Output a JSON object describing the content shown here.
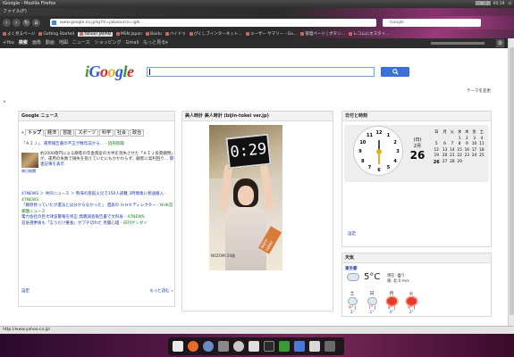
{
  "window": {
    "title": "iGoogle - Mozilla Firefox",
    "clock": "00:19",
    "user_label": "▒▒▒▒▒"
  },
  "menu": {
    "label": "ファイル(F)"
  },
  "nav": {
    "url": "www.google.co.jp/ig?hl=ja&source=iglk",
    "search_placeholder": "Google"
  },
  "bookmarks": [
    {
      "label": "よく見るページ"
    },
    {
      "label": "Getting Started"
    },
    {
      "label": "Yahoo! JAPAN"
    },
    {
      "label": "MSN Japan"
    },
    {
      "label": "Baidu"
    },
    {
      "label": "バイドゥ"
    },
    {
      "label": "ぴくしブインターネット…"
    },
    {
      "label": "ユーザー サマリー - Go…"
    },
    {
      "label": "管理ページ | ボタン…"
    },
    {
      "label": "レコムにオスタイ…"
    }
  ],
  "gbar": {
    "items": [
      "+You",
      "検索",
      "画像",
      "動画",
      "地図",
      "ニュース",
      "ショッピング",
      "Gmail",
      "もっと見る▾"
    ],
    "gear_label": "⚙"
  },
  "logo": {
    "i": "i",
    "G": "G",
    "o1": "o",
    "o2": "o",
    "g": "g",
    "l": "l",
    "e": "e"
  },
  "search": {
    "value": ""
  },
  "theme_link": "テーマを変更",
  "collapse_arrow": "▸",
  "news": {
    "title": "Google ニュース",
    "prev": "«",
    "tabs": [
      "トップ",
      "経済",
      "芸能",
      "スポーツ",
      "科学",
      "社会",
      "政治"
    ],
    "headline": "「ＡＩＪ」、運用報告書の不正が数年前から…",
    "headline_source": "- 読売新聞",
    "lead_parts": [
      "約2000億円による顧客の年金資産の大半を消失させた「ＡＩＪ投資顧問」が、運用の失敗で損失を抱えていたにもかかわらず、顧客に高利回り…",
      "関連記事を表示"
    ],
    "thumb_caption": "毎日新聞",
    "items": [
      {
        "text": "47NEWS ＞ 共同ニュース ＞ 熟海の旅館火災で150人避難 3時間後に移送搬入",
        "source": "- 47NEWS"
      },
      {
        "text": "「藤原修っていたが遺法とは分からなかった」 遺族の ＮＨＫディレクター",
        "source": "- NHK首都圏ニュース"
      },
      {
        "text": "電力会社の巨大津波警報を修正 発震調査報告書で文科省 -",
        "source": "47NEWS"
      },
      {
        "text": "首長選挙後も「言うだけ番長」がプチ切れた 見聞心理 -",
        "source": "日刊ゲンダイ"
      }
    ],
    "settings": "設定",
    "more": "もっと読む »"
  },
  "bijin": {
    "title": "美人時計 美人時計 (bijin-tokei ver.jp)",
    "time": "0:29",
    "stamp": "bijin-tokei",
    "credit": "NOZOMI 20歳"
  },
  "datetime": {
    "title": "日付と時刻",
    "day_label": "(日)",
    "month_label": "2月",
    "day": "26",
    "clock_numbers": [
      "12",
      "1",
      "2",
      "3",
      "4",
      "5",
      "6",
      "7",
      "8",
      "9",
      "10",
      "11"
    ],
    "weekdays": [
      "日",
      "月",
      "火",
      "水",
      "木",
      "金",
      "土"
    ],
    "weeks": [
      [
        "",
        "",
        "",
        "1",
        "2",
        "3",
        "4"
      ],
      [
        "5",
        "6",
        "7",
        "8",
        "9",
        "10",
        "11"
      ],
      [
        "12",
        "13",
        "14",
        "15",
        "16",
        "17",
        "18"
      ],
      [
        "19",
        "20",
        "21",
        "22",
        "23",
        "24",
        "25"
      ],
      [
        "26",
        "27",
        "28",
        "29",
        "",
        "",
        ""
      ]
    ],
    "settings": "設定"
  },
  "weather": {
    "title": "天気",
    "city": "東京都",
    "temp": "5°C",
    "condition": "現在: 曇り",
    "wind": "風: 北 0 m/s",
    "days": [
      {
        "name": "土",
        "hi": "9°",
        "lo": "3°",
        "kind": "cloud"
      },
      {
        "name": "日",
        "hi": "7°",
        "lo": "1°",
        "kind": "cloud"
      },
      {
        "name": "月",
        "hi": "8°",
        "lo": "0°",
        "kind": "sun"
      },
      {
        "name": "火",
        "hi": "9°",
        "lo": "3°",
        "kind": "sun"
      }
    ]
  },
  "status": {
    "text": "http://www.yahoo.co.jp/"
  }
}
